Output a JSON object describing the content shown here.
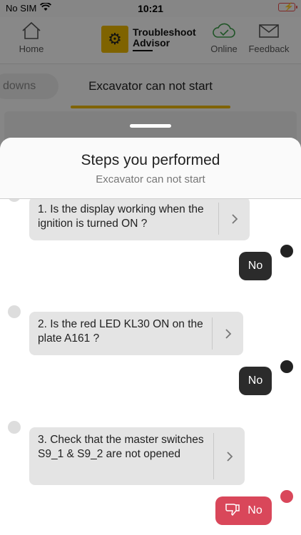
{
  "status": {
    "carrier": "No SIM",
    "time": "10:21"
  },
  "header": {
    "home_label": "Home",
    "logo_line1": "Troubleshoot",
    "logo_line2": "Advisor",
    "online_label": "Online",
    "feedback_label": "Feedback"
  },
  "tabs": {
    "partial_label": "downs",
    "active_label": "Excavator can not start"
  },
  "sheet": {
    "title": "Steps you performed",
    "subtitle": "Excavator can not start",
    "steps": [
      {
        "question": "1. Is the display working when the ignition is turned ON ?",
        "answer": "No"
      },
      {
        "question": "2. Is the red LED KL30 ON on the plate A161 ?",
        "answer": "No"
      },
      {
        "question": "3. Check that the master switches S9_1 & S9_2 are not opened",
        "answer": "No"
      }
    ]
  },
  "colors": {
    "accent": "#e8b400",
    "answer_dark": "#2b2b2b",
    "answer_negative": "#d9475a"
  }
}
